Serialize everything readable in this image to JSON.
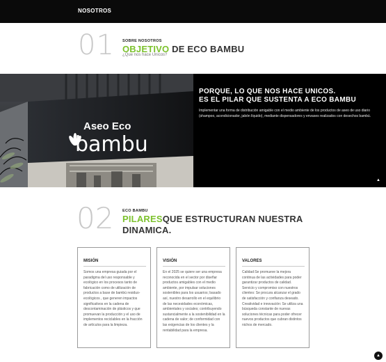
{
  "nav": {
    "title": "NOSOTROS"
  },
  "section1": {
    "number": "01",
    "kicker": "SOBRE NOSOTROS",
    "heading_accent": "OBJETIVO",
    "heading_rest": " DE ECO BAMBU",
    "subtitle": "¿Que nos hace Unicos?"
  },
  "hero": {
    "sign_top": "Aseo Eco",
    "sign_bottom": "bambu",
    "title_line1": "PORQUE, LO QUE NOS HACE UNICOS.",
    "title_line2": "ES EL PILAR QUE SUSTENTA A ECO BAMBU",
    "body": "Implementar una forma de distribución amigable con el medio ambiente de los productos de aseo de uso diario (shampoo, acondicionador, jabón líquido), mediante dispensadores y envases realizados con desechos bambú.",
    "colors": {
      "background": "#000000",
      "text": "#ffffff"
    }
  },
  "section2": {
    "number": "02",
    "kicker": "ECO BAMBU",
    "heading_accent": "PILARES",
    "heading_rest": "QUE ESTRUCTURAN NUESTRA DINAMICA.",
    "cards": [
      {
        "title": "MISIÓN",
        "body": "Somos una empresa guiada por el paradigma del uso responsable y ecológico en los procesos tanto de fabricación como de utilización de productos a base de bambú residuo-ecológicos , que generen impactos significativos en la cadena de descontaminación de plásticos y que promuevan la producción y el uso de implementos reciclables en la fracción de artículos para la limpieza."
      },
      {
        "title": "VISIÓN",
        "body": "En el 2025 se quiere ser una empresa reconocida en el sector por diseñar productos amigables con el medio ambiente, por impulsar soluciones sostenibles para los usuarios; basado así, nuestro desarrollo en el equilibrio de las necesidades económicas, ambientales y sociales; contribuyendo sustancialmente a la sostenibilidad en la cadena de valor; de conformidad con las exigencias de los clientes y la rentabilidad para la empresa."
      },
      {
        "title": "VALORES",
        "body": "Calidad:Se promueve la mejora continua de las actividades para poder garantizar productos de calidad. Servicio y compromiso con nuestros clientes: Se procura alcanzar el grado de satisfacción y confianza deseado. Creatividad e innovación: Se utiliza una búsqueda constante de nuevas soluciones técnicas para poder ofrecer nuevos productos que cubran distintos nichos de mercado."
      }
    ]
  },
  "colors": {
    "accent": "#7cc22d",
    "dark": "#0a0a0a",
    "number_gray": "#c8c8c8"
  },
  "icons": {
    "scroll_up": "chevron-up-icon",
    "back_to_top": "arrow-up-icon"
  }
}
